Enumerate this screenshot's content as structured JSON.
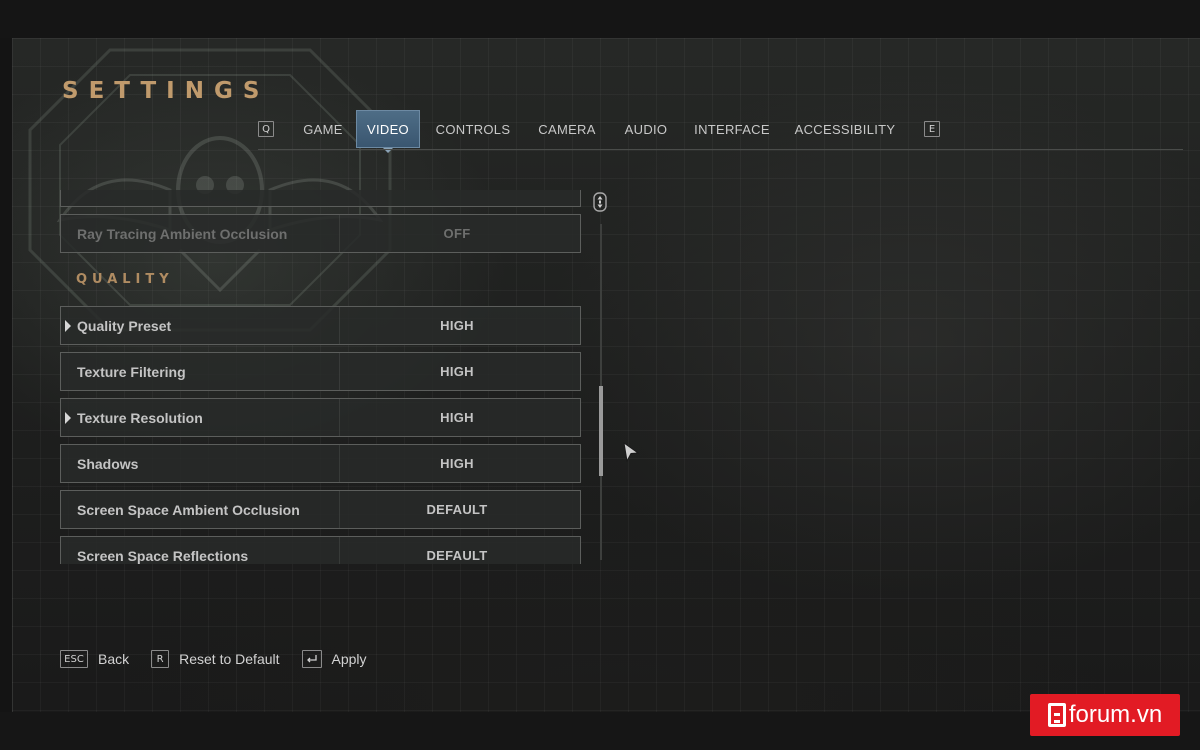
{
  "header": {
    "title": "SETTINGS"
  },
  "tabs": {
    "prev_key": "Q",
    "next_key": "E",
    "items": [
      {
        "label": "GAME",
        "active": false
      },
      {
        "label": "VIDEO",
        "active": true
      },
      {
        "label": "CONTROLS",
        "active": false
      },
      {
        "label": "CAMERA",
        "active": false
      },
      {
        "label": "AUDIO",
        "active": false
      },
      {
        "label": "INTERFACE",
        "active": false
      },
      {
        "label": "ACCESSIBILITY",
        "active": false
      }
    ]
  },
  "settings": {
    "partial_row": {
      "label": "",
      "value": ""
    },
    "ray_tracing": {
      "label": "Ray Tracing Ambient Occlusion",
      "value": "OFF"
    },
    "section_title": "QUALITY",
    "rows": [
      {
        "label": "Quality Preset",
        "value": "HIGH",
        "expandable": true
      },
      {
        "label": "Texture Filtering",
        "value": "HIGH",
        "expandable": false
      },
      {
        "label": "Texture Resolution",
        "value": "HIGH",
        "expandable": true
      },
      {
        "label": "Shadows",
        "value": "HIGH",
        "expandable": false
      },
      {
        "label": "Screen Space Ambient Occlusion",
        "value": "DEFAULT",
        "expandable": false
      },
      {
        "label": "Screen Space Reflections",
        "value": "DEFAULT",
        "expandable": false
      }
    ]
  },
  "footer": {
    "back": {
      "key": "ESC",
      "label": "Back"
    },
    "reset": {
      "key": "R",
      "label": "Reset to Default"
    },
    "apply": {
      "key_icon": "enter-key-icon",
      "label": "Apply"
    }
  },
  "watermark": {
    "text": "forum.vn",
    "color": "#e21b24"
  },
  "colors": {
    "accent_title": "#c09a6c",
    "active_tab": "#4e6d86"
  }
}
